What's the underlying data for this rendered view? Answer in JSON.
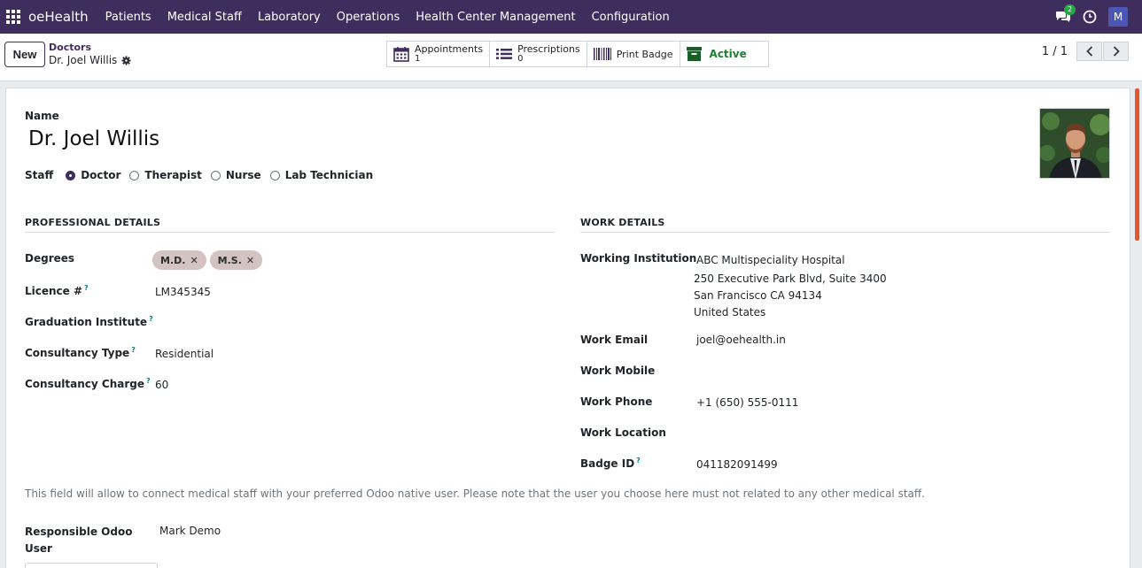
{
  "navbar": {
    "brand": "oeHealth",
    "menu": [
      "Patients",
      "Medical Staff",
      "Laboratory",
      "Operations",
      "Health Center Management",
      "Configuration"
    ],
    "chat_count": "2",
    "user_initial": "M",
    "colors": {
      "bar": "#3f2d5d",
      "avatar": "#4c56b5",
      "badge": "#28a745"
    }
  },
  "control": {
    "new_label": "New",
    "breadcrumb_parent": "Doctors",
    "breadcrumb_current": "Dr. Joel Willis",
    "stats": {
      "appointments_label": "Appointments",
      "appointments_count": "1",
      "prescriptions_label": "Prescriptions",
      "prescriptions_count": "0",
      "print_badge_label": "Print Badge",
      "active_label": "Active"
    },
    "pager": "1 / 1"
  },
  "form": {
    "name_label": "Name",
    "name_value": "Dr. Joel Willis",
    "staff_label": "Staff",
    "staff_options": [
      "Doctor",
      "Therapist",
      "Nurse",
      "Lab Technician"
    ],
    "staff_selected": "Doctor",
    "professional": {
      "title": "PROFESSIONAL DETAILS",
      "degrees_label": "Degrees",
      "degrees": [
        "M.D.",
        "M.S."
      ],
      "licence_label": "Licence #",
      "licence_value": "LM345345",
      "graduation_label": "Graduation Institute",
      "graduation_value": "",
      "consultancy_type_label": "Consultancy Type",
      "consultancy_type_value": "Residential",
      "consultancy_charge_label": "Consultancy Charge",
      "consultancy_charge_value": "60"
    },
    "work": {
      "title": "WORK DETAILS",
      "institution_label": "Working Institution",
      "institution_name": "ABC Multispeciality Hospital",
      "address_line1": "250 Executive Park Blvd, Suite 3400",
      "address_line2": "San Francisco CA 94134",
      "address_line3": "United States",
      "email_label": "Work Email",
      "email_value": "joel@oehealth.in",
      "mobile_label": "Work Mobile",
      "mobile_value": "",
      "phone_label": "Work Phone",
      "phone_value": "+1 (650) 555-0111",
      "location_label": "Work Location",
      "location_value": "",
      "badge_label": "Badge ID",
      "badge_value": "041182091499"
    },
    "help_mark": "?",
    "note": "This field will allow to connect medical staff with your preferred Odoo native user. Please note that the user you choose here must not related to any other medical staff.",
    "responsible_label_1": "Responsible Odoo",
    "responsible_label_2": "User",
    "responsible_value": "Mark Demo"
  }
}
